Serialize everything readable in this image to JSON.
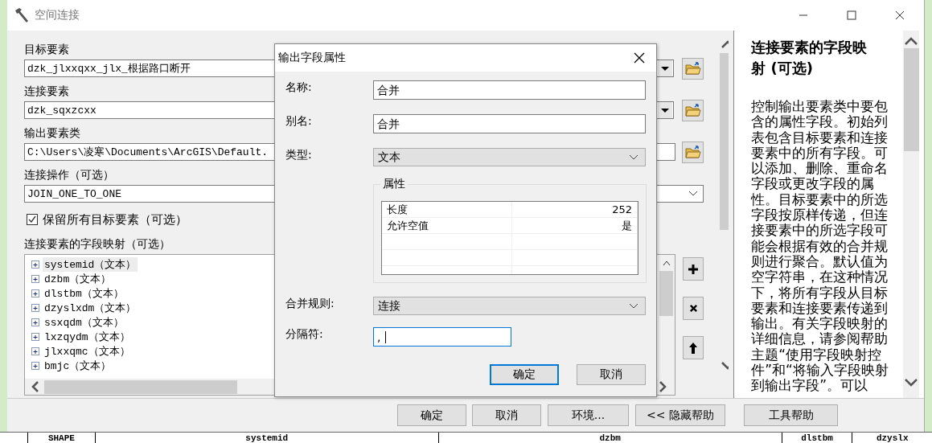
{
  "window": {
    "title": "空间连接"
  },
  "form": {
    "fields": [
      {
        "label": "目标要素",
        "value": "dzk_jlxxqxx_jlx_根据路口断开",
        "kind": "dropdown-browse"
      },
      {
        "label": "连接要素",
        "value": "dzk_sqxzcxx",
        "kind": "dropdown-browse"
      },
      {
        "label": "输出要素类",
        "value": "C:\\Users\\凌寒\\Documents\\ArcGIS\\Default.",
        "kind": "browse"
      },
      {
        "label": "连接操作（可选）",
        "value": "JOIN_ONE_TO_ONE",
        "kind": "select"
      }
    ],
    "keep_all": {
      "label": "保留所有目标要素（可选）",
      "checked": true
    },
    "field_map": {
      "label": "连接要素的字段映射（可选）",
      "items": [
        {
          "label": "systemid（文本）",
          "selected": true,
          "expanded": false
        },
        {
          "label": "dzbm（文本）",
          "selected": false,
          "expanded": false
        },
        {
          "label": "dlstbm（文本）",
          "selected": false,
          "expanded": false
        },
        {
          "label": "dzyslxdm（文本）",
          "selected": false,
          "expanded": false
        },
        {
          "label": "ssxqdm（文本）",
          "selected": false,
          "expanded": false
        },
        {
          "label": "lxzqydm（文本）",
          "selected": false,
          "expanded": false
        },
        {
          "label": "jlxxqmc（文本）",
          "selected": false,
          "expanded": false
        },
        {
          "label": "bmjc（文本）",
          "selected": false,
          "expanded": false
        }
      ],
      "tools": [
        {
          "kind": "add"
        },
        {
          "kind": "remove"
        },
        {
          "kind": "up"
        }
      ]
    }
  },
  "buttons": [
    {
      "label": "确定"
    },
    {
      "label": "取消"
    },
    {
      "label": "环境..."
    },
    {
      "label": "<< 隐藏帮助"
    },
    {
      "label": "工具帮助"
    }
  ],
  "help": {
    "title": "连接要素的字段映射 (可选)",
    "body": "控制输出要素类中要包含的属性字段。初始列表包含目标要素和连接要素中的所有字段。可以添加、删除、重命名字段或更改字段的属性。目标要素中的所选字段按原样传递，但连接要素中的所选字段可能会根据有效的合并规则进行聚合。默认值为空字符串，在这种情况下，将所有字段从目标要素和连接要素传递到输出。有关字段映射的详细信息，请参阅帮助主题“使用字段映射控件”和“将输入字段映射到输出字段”。可以"
  },
  "dialog": {
    "title": "输出字段属性",
    "name": {
      "label": "名称:",
      "value": "合并"
    },
    "alias": {
      "label": "别名:",
      "value": "合并"
    },
    "type": {
      "label": "类型:",
      "value": "文本"
    },
    "properties": {
      "title": "属性",
      "rows": [
        {
          "name": "长度",
          "value": "252"
        },
        {
          "name": "允许空值",
          "value": "是"
        }
      ]
    },
    "merge_rule": {
      "label": "合并规则:",
      "value": "连接"
    },
    "delimiter": {
      "label": "分隔符:",
      "value": ",",
      "focused": true
    },
    "buttons": [
      {
        "label": "确定",
        "default": true
      },
      {
        "label": "取消",
        "default": false
      }
    ]
  },
  "table_header": [
    "SHAPE",
    "systemid",
    "dzbm",
    "dlstbm",
    "dzyslx"
  ]
}
